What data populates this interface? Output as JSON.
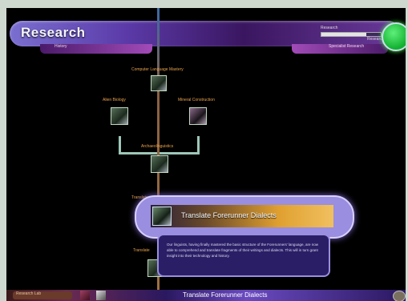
{
  "header": {
    "title": "Research",
    "left_tab_label": "History",
    "right_tab_label": "Specialist Research",
    "progress_label": "Research",
    "progress_fraction": 0.75,
    "progress_value": "Research",
    "status_color": "#22c840"
  },
  "tree": {
    "nodes": [
      {
        "label": "Computer Language Mastery"
      },
      {
        "label": "Alien Biology"
      },
      {
        "label": "Mineral Construction"
      },
      {
        "label": "Archaeolinguistics"
      },
      {
        "label": "Translate"
      },
      {
        "label": "Translate"
      }
    ]
  },
  "selected": {
    "title": "Translate Forerunner Dialects",
    "description": "Our linguists, having finally mastered the basic structure of the Forerunners' language, are now able to comprehend and translate fragments of their writings and dialects. This will in turn grant insight into their technology and history."
  },
  "bottom": {
    "left_label": "Research Lab",
    "center_title": "Translate Forerunner Dialects"
  },
  "colors": {
    "accent_purple": "#6a4ac0",
    "label_orange": "#e7a24a",
    "status_green": "#22c840"
  },
  "icons": [
    "alien-tech-icon",
    "status-orb-icon"
  ]
}
